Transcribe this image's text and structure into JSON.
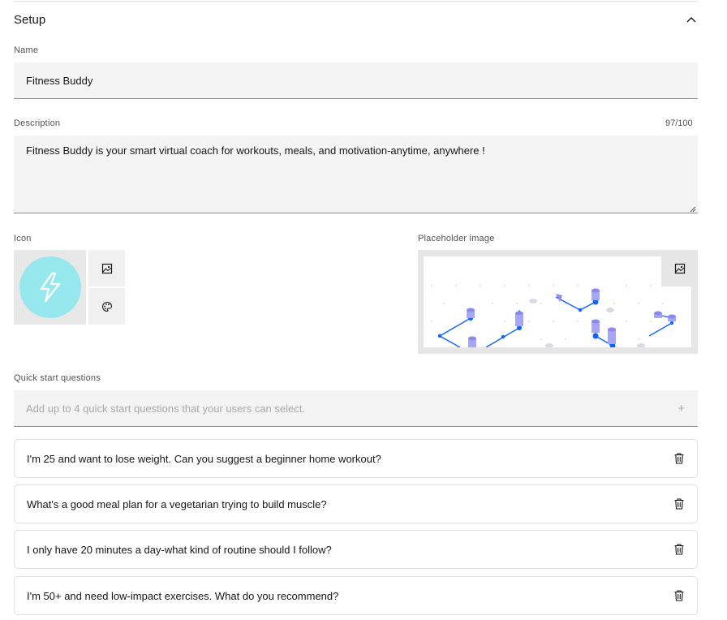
{
  "section": {
    "title": "Setup"
  },
  "name": {
    "label": "Name",
    "value": "Fitness Buddy"
  },
  "description": {
    "label": "Description",
    "counter": "97/100",
    "value": "Fitness Buddy is your smart virtual coach for workouts, meals, and motivation-anytime, anywhere !"
  },
  "icon": {
    "label": "Icon",
    "color": "#97e7ef",
    "glyph": "lightning-bolt-icon"
  },
  "placeholder_image": {
    "label": "Placeholder image"
  },
  "quick_start": {
    "label": "Quick start questions",
    "placeholder": "Add up to 4 quick start questions that your users can select.",
    "add_symbol": "+",
    "questions": [
      "I'm 25 and want to lose weight. Can you suggest a beginner home workout?",
      "What's a good meal plan for a vegetarian trying to build muscle?",
      "I only have 20 minutes a day-what kind of routine should I follow?",
      "I'm 50+ and need low-impact exercises. What do you recommend?"
    ]
  },
  "colors": {
    "accent": "#0f62fe",
    "field_bg": "#f4f4f4",
    "border": "#e0e0e0"
  }
}
